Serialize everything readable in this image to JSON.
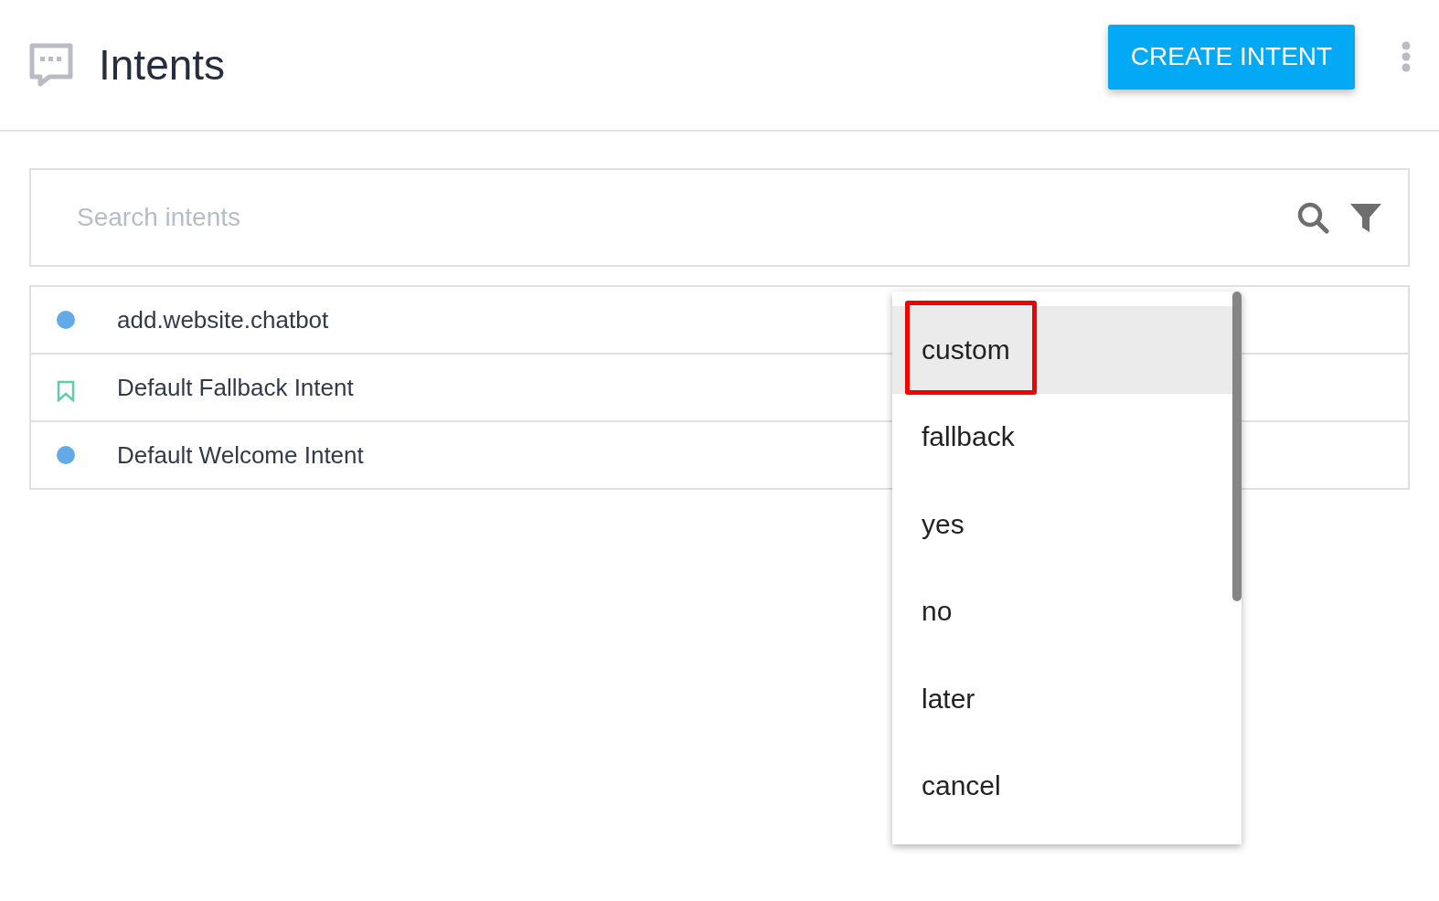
{
  "header": {
    "title": "Intents",
    "create_button": "CREATE INTENT"
  },
  "search": {
    "placeholder": "Search intents"
  },
  "intents": [
    {
      "name": "add.website.chatbot",
      "kind": "dot",
      "color": "#64aae8"
    },
    {
      "name": "Default Fallback Intent",
      "kind": "bookmark",
      "color": "#5ccfa8"
    },
    {
      "name": "Default Welcome Intent",
      "kind": "dot",
      "color": "#64aae8"
    }
  ],
  "menu": {
    "items": [
      {
        "label": "custom",
        "selected": true,
        "highlighted": true
      },
      {
        "label": "fallback",
        "selected": false,
        "highlighted": false
      },
      {
        "label": "yes",
        "selected": false,
        "highlighted": false
      },
      {
        "label": "no",
        "selected": false,
        "highlighted": false
      },
      {
        "label": "later",
        "selected": false,
        "highlighted": false
      },
      {
        "label": "cancel",
        "selected": false,
        "highlighted": false
      }
    ]
  }
}
